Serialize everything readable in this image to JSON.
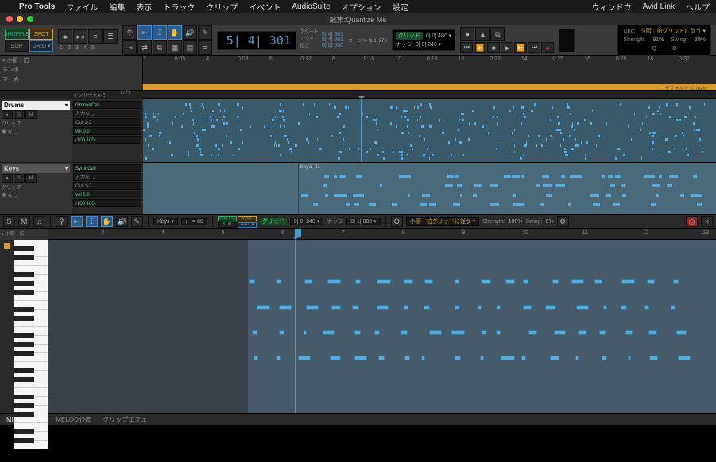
{
  "menu": {
    "app": "Pro Tools",
    "items": [
      "ファイル",
      "編集",
      "表示",
      "トラック",
      "クリップ",
      "イベント",
      "AudioSuite",
      "オプション",
      "設定"
    ],
    "right": [
      "ウィンドウ",
      "Avid Link",
      "ヘルプ"
    ]
  },
  "window": {
    "title": "編集:Quantize Me"
  },
  "toolbar": {
    "modes": {
      "shuffle": "SHUFFLE",
      "spot": "SPOT",
      "slip": "SLIP",
      "grid": "GRID ▾"
    },
    "num_labels": [
      "1",
      "2",
      "3",
      "4",
      "5"
    ],
    "counter_main": "5| 4| 301",
    "counter_labels": [
      "スタート",
      "エンド",
      "長さ"
    ],
    "counter_vals": [
      "5| 4| 301",
      "5| 4| 301",
      "0| 0| 000"
    ],
    "cursor_label": "カーソル",
    "cursor_val": "9| 1| 278",
    "nudge": {
      "grid_label": "グリッド",
      "grid_val": "0| 0| 480 ▾",
      "nudge_label": "ナッジ",
      "nudge_val": "0| 0| 240 ▾"
    },
    "right": {
      "grid_label": "Grid:",
      "grid_val": "小節｜拍グリッドに従う ▾",
      "strength_label": "Strength:",
      "strength_val": "91%",
      "swing_label": "Swing:",
      "swing_val": "39%"
    }
  },
  "ruler": {
    "head": "▾ 小節｜拍",
    "ticks": [
      {
        "l": "2",
        "p": 0
      },
      {
        "l": "0:05",
        "p": 5.5
      },
      {
        "l": "4",
        "p": 11
      },
      {
        "l": "0:08",
        "p": 16.5
      },
      {
        "l": "6",
        "p": 22
      },
      {
        "l": "0:12",
        "p": 27.5
      },
      {
        "l": "8",
        "p": 33
      },
      {
        "l": "0:15",
        "p": 38.5
      },
      {
        "l": "10",
        "p": 44
      },
      {
        "l": "0:18",
        "p": 49.5
      },
      {
        "l": "12",
        "p": 55
      },
      {
        "l": "0:22",
        "p": 60.5
      },
      {
        "l": "14",
        "p": 66
      },
      {
        "l": "0:25",
        "p": 71.5
      },
      {
        "l": "16",
        "p": 77
      },
      {
        "l": "0:28",
        "p": 82.5
      },
      {
        "l": "18",
        "p": 88
      },
      {
        "l": "0:32",
        "p": 93.5
      }
    ],
    "rows": [
      "テンポ",
      "マーカー"
    ],
    "conductor_label": "デフォルト: C major"
  },
  "tracks": [
    {
      "name": "Drums",
      "insert_hdr": "インサートA-E",
      "io_hdr": "I / O",
      "insert": "GrooveCel",
      "in": "入力なし",
      "out": "Out 1-2",
      "vol": "vol   0.0",
      "pan": "‹100  100›",
      "clip": "クリップ",
      "none": "◉ なし",
      "height": 80
    },
    {
      "name": "Keys",
      "insert": "SynthCell",
      "in": "入力なし",
      "out": "Out 1-2",
      "vol": "vol   0.0",
      "pan": "‹100  100›",
      "clip": "クリップ",
      "none": "◉ なし",
      "clip_label": "Keyミ-01",
      "height": 65
    }
  ],
  "midi": {
    "track_sel": "Keys ▾",
    "tempo": "♩ = 80",
    "modes": {
      "shuffle": "SHUFFLE",
      "spot": "SPOT",
      "slip": "SLIP",
      "grid": "GRID ▾"
    },
    "grid_pill": "グリッド",
    "grid_val": "0| 0| 240 ▾",
    "nudge_label": "ナッジ",
    "nudge_val": "0| 1| 000 ▾",
    "q_label": "小節｜拍グリッドに従う ▾",
    "strength_label": "Strength:",
    "strength_val": "100%",
    "swing_label": "Swing:",
    "swing_val": "0%",
    "ruler_head": "▾ 小節｜拍",
    "ruler_ticks": [
      {
        "l": "3",
        "p": 8
      },
      {
        "l": "4",
        "p": 17
      },
      {
        "l": "5",
        "p": 26
      },
      {
        "l": "6",
        "p": 35
      },
      {
        "l": "7",
        "p": 44
      },
      {
        "l": "8",
        "p": 53
      },
      {
        "l": "9",
        "p": 62
      },
      {
        "l": "10",
        "p": 71
      },
      {
        "l": "11",
        "p": 80
      },
      {
        "l": "12",
        "p": 89
      },
      {
        "l": "13",
        "p": 98
      }
    ]
  },
  "bottom": {
    "tabs": [
      "MIDIエディタ",
      "MELODYNE",
      "クリップエフェ"
    ]
  }
}
